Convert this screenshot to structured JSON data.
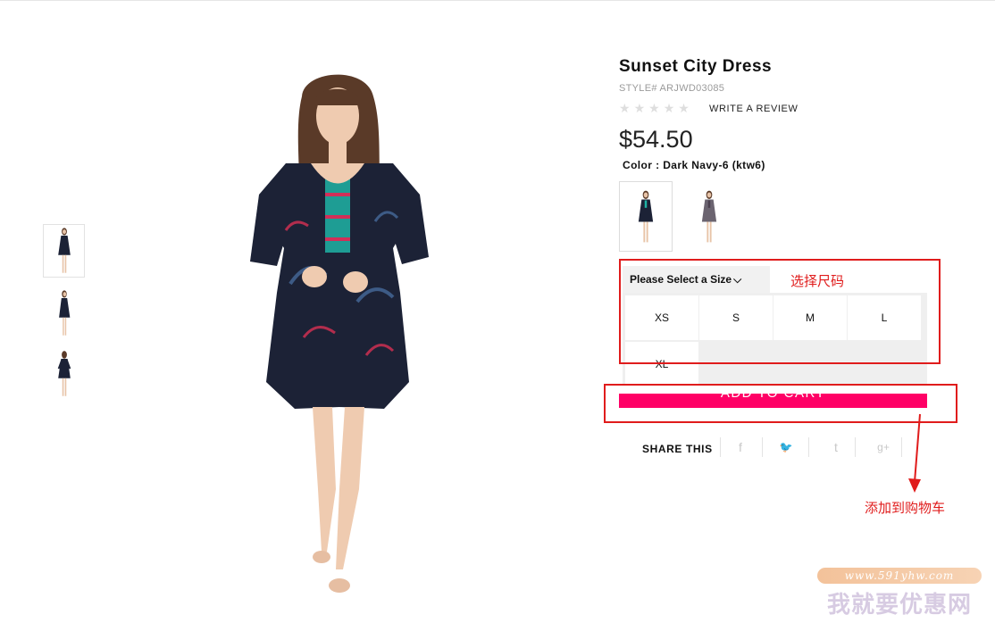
{
  "product": {
    "title": "Sunset City Dress",
    "style_label": "STYLE# ARJWD03085",
    "rating": {
      "filled": 0,
      "total": 5
    },
    "write_review": "WRITE A REVIEW",
    "price": "$54.50",
    "color_label": "Color : Dark Navy-6 (ktw6)"
  },
  "size_selector": {
    "header": "Please Select a Size",
    "sizes": [
      "XS",
      "S",
      "M",
      "L",
      "XL"
    ]
  },
  "add_to_cart": "ADD TO CART",
  "share": {
    "label": "SHARE THIS",
    "icons": [
      "facebook-icon",
      "twitter-icon",
      "tumblr-icon",
      "google-plus-icon"
    ],
    "glyphs": [
      "f",
      "🐦",
      "t",
      "g+"
    ]
  },
  "annotations": {
    "size_note": "选择尺码",
    "cart_note": "添加到购物车"
  },
  "watermark": {
    "url": "www.591yhw.com",
    "name": "我就要优惠网"
  },
  "colors": {
    "accent": "#ff0066",
    "annotation": "#e01c1c",
    "dress": "#1c2236"
  }
}
